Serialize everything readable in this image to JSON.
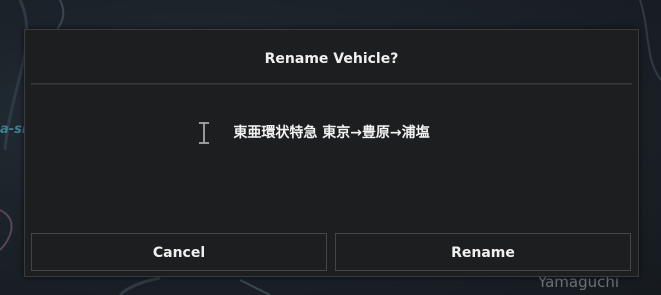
{
  "map": {
    "label_left": "a-si",
    "label_city": "Yamaguchi"
  },
  "dialog": {
    "title": "Rename Vehicle?",
    "name_input": {
      "value": "東亜環状特急 東京→豊原→浦塩"
    },
    "buttons": {
      "cancel_label": "Cancel",
      "rename_label": "Rename"
    }
  },
  "colors": {
    "dialog_bg": "#1d1e1f",
    "text": "#f0f0f0",
    "button_border": "#444548"
  }
}
